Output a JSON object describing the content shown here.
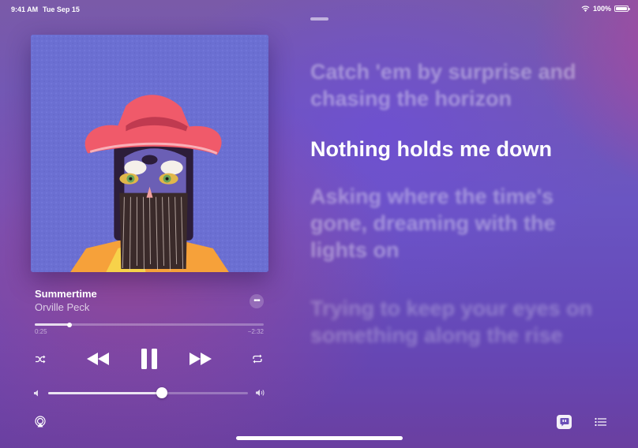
{
  "status_bar": {
    "time": "9:41 AM",
    "date": "Tue Sep 15",
    "battery": "100%"
  },
  "now_playing": {
    "title": "Summertime",
    "artist": "Orville Peck",
    "elapsed": "0:25",
    "remaining": "−2:32",
    "progress": 0.15,
    "volume": 0.57
  },
  "lyrics": {
    "past": "Catch 'em by surprise and chasing the horizon",
    "current": "Nothing holds me down",
    "next": "Asking where the time's gone, dreaming with the lights on",
    "later": "Trying to keep your eyes on something along the rise"
  },
  "icons": {
    "more": "more-icon",
    "shuffle": "shuffle-icon",
    "rewind": "rewind-icon",
    "pause": "pause-icon",
    "fast_forward": "fast-forward-icon",
    "repeat": "repeat-icon",
    "volume_low": "volume-low-icon",
    "volume_high": "volume-high-icon",
    "airplay": "airplay-icon",
    "lyrics": "lyrics-icon",
    "queue": "queue-icon"
  }
}
